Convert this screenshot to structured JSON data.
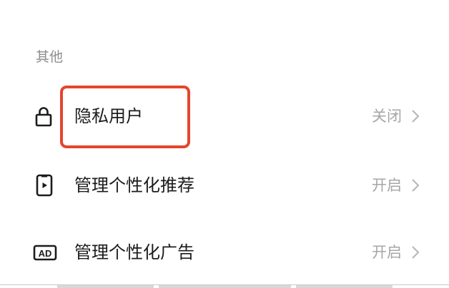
{
  "section": {
    "title": "其他"
  },
  "rows": [
    {
      "icon": "lock-icon",
      "label": "隐私用户",
      "value": "关闭"
    },
    {
      "icon": "phone-play-icon",
      "label": "管理个性化推荐",
      "value": "开启"
    },
    {
      "icon": "ad-icon",
      "label": "管理个性化广告",
      "value": "开启"
    }
  ],
  "colors": {
    "highlight": "#e5452d",
    "text_primary": "#1c1c1c",
    "text_secondary": "#a6a6a6",
    "section_header": "#8c8c8c"
  }
}
